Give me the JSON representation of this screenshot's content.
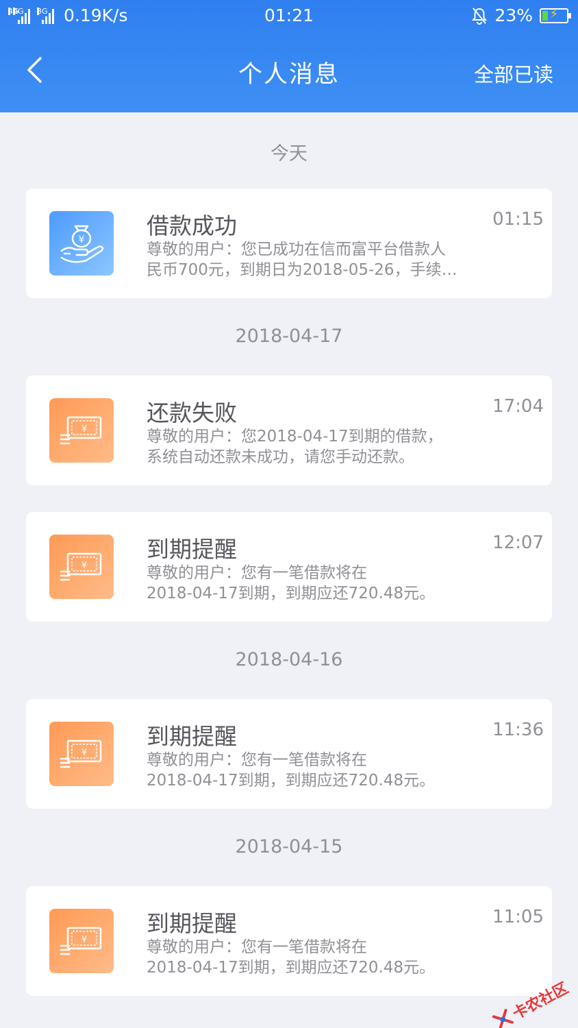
{
  "status_bar": {
    "network_1": "4G",
    "network_2": "4G",
    "network_3": "3G",
    "speed": "0.19K/s",
    "time": "01:21",
    "battery": "23%",
    "battery_level": 0.23
  },
  "nav": {
    "title": "个人消息",
    "mark_all_read": "全部已读",
    "back_icon": "chevron-left-icon"
  },
  "groups": [
    {
      "date": "今天",
      "messages": [
        {
          "icon": "loan-hand-icon",
          "icon_color": "#4d9bff",
          "title": "借款成功",
          "time": "01:15",
          "body_line1": "尊敬的用户：您已成功在信而富平台借款人",
          "body_line2": "民币700元，到期日为2018-05-26，手续…"
        }
      ]
    },
    {
      "date": "2018-04-17",
      "messages": [
        {
          "icon": "banknote-icon",
          "icon_color": "#ff9a55",
          "title": "还款失败",
          "time": "17:04",
          "body_line1": "尊敬的用户：您2018-04-17到期的借款，",
          "body_line2": "系统自动还款未成功，请您手动还款。"
        },
        {
          "icon": "banknote-icon",
          "icon_color": "#ff9a55",
          "title": "到期提醒",
          "time": "12:07",
          "body_line1": "尊敬的用户：您有一笔借款将在",
          "body_line2": "2018-04-17到期，到期应还720.48元。"
        }
      ]
    },
    {
      "date": "2018-04-16",
      "messages": [
        {
          "icon": "banknote-icon",
          "icon_color": "#ff9a55",
          "title": "到期提醒",
          "time": "11:36",
          "body_line1": "尊敬的用户：您有一笔借款将在",
          "body_line2": "2018-04-17到期，到期应还720.48元。"
        }
      ]
    },
    {
      "date": "2018-04-15",
      "messages": [
        {
          "icon": "banknote-icon",
          "icon_color": "#ff9a55",
          "title": "到期提醒",
          "time": "11:05",
          "body_line1": "尊敬的用户：您有一笔借款将在",
          "body_line2": "2018-04-17到期，到期应还720.48元。"
        }
      ]
    }
  ],
  "watermark": {
    "text": "卡农社区"
  }
}
